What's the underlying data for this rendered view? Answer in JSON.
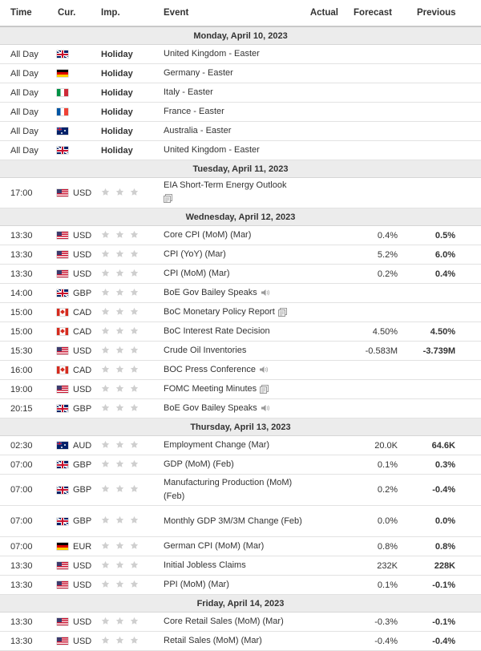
{
  "header": {
    "time": "Time",
    "currency": "Cur.",
    "importance": "Imp.",
    "event": "Event",
    "actual": "Actual",
    "forecast": "Forecast",
    "previous": "Previous"
  },
  "colors": {
    "day_bg": "#ececec",
    "star": "#cfcfcf",
    "text": "#333333"
  },
  "days": [
    {
      "label": "Monday, April 10, 2023",
      "events": [
        {
          "time": "All Day",
          "flag": "gb",
          "currency": "",
          "importance": "Holiday",
          "event": "United Kingdom - Easter",
          "icon": "",
          "actual": "",
          "forecast": "",
          "previous": ""
        },
        {
          "time": "All Day",
          "flag": "de",
          "currency": "",
          "importance": "Holiday",
          "event": "Germany - Easter",
          "icon": "",
          "actual": "",
          "forecast": "",
          "previous": ""
        },
        {
          "time": "All Day",
          "flag": "it",
          "currency": "",
          "importance": "Holiday",
          "event": "Italy - Easter",
          "icon": "",
          "actual": "",
          "forecast": "",
          "previous": ""
        },
        {
          "time": "All Day",
          "flag": "fr",
          "currency": "",
          "importance": "Holiday",
          "event": "France - Easter",
          "icon": "",
          "actual": "",
          "forecast": "",
          "previous": ""
        },
        {
          "time": "All Day",
          "flag": "au",
          "currency": "",
          "importance": "Holiday",
          "event": "Australia - Easter",
          "icon": "",
          "actual": "",
          "forecast": "",
          "previous": ""
        },
        {
          "time": "All Day",
          "flag": "gb",
          "currency": "",
          "importance": "Holiday",
          "event": "United Kingdom - Easter",
          "icon": "",
          "actual": "",
          "forecast": "",
          "previous": ""
        }
      ]
    },
    {
      "label": "Tuesday, April 11, 2023",
      "events": [
        {
          "time": "17:00",
          "flag": "us",
          "currency": "USD",
          "importance": "stars",
          "event": "EIA Short-Term Energy Outlook",
          "icon": "document-icon-block",
          "actual": "",
          "forecast": "",
          "previous": "",
          "rows": 2
        }
      ]
    },
    {
      "label": "Wednesday, April 12, 2023",
      "events": [
        {
          "time": "13:30",
          "flag": "us",
          "currency": "USD",
          "importance": "stars",
          "event": "Core CPI (MoM) (Mar)",
          "icon": "",
          "actual": "",
          "forecast": "0.4%",
          "previous": "0.5%"
        },
        {
          "time": "13:30",
          "flag": "us",
          "currency": "USD",
          "importance": "stars",
          "event": "CPI (YoY) (Mar)",
          "icon": "",
          "actual": "",
          "forecast": "5.2%",
          "previous": "6.0%"
        },
        {
          "time": "13:30",
          "flag": "us",
          "currency": "USD",
          "importance": "stars",
          "event": "CPI (MoM) (Mar)",
          "icon": "",
          "actual": "",
          "forecast": "0.2%",
          "previous": "0.4%"
        },
        {
          "time": "14:00",
          "flag": "gb",
          "currency": "GBP",
          "importance": "stars",
          "event": "BoE Gov Bailey Speaks",
          "icon": "speaker-icon",
          "actual": "",
          "forecast": "",
          "previous": ""
        },
        {
          "time": "15:00",
          "flag": "ca",
          "currency": "CAD",
          "importance": "stars",
          "event": "BoC Monetary Policy Report",
          "icon": "document-icon",
          "actual": "",
          "forecast": "",
          "previous": ""
        },
        {
          "time": "15:00",
          "flag": "ca",
          "currency": "CAD",
          "importance": "stars",
          "event": "BoC Interest Rate Decision",
          "icon": "",
          "actual": "",
          "forecast": "4.50%",
          "previous": "4.50%"
        },
        {
          "time": "15:30",
          "flag": "us",
          "currency": "USD",
          "importance": "stars",
          "event": "Crude Oil Inventories",
          "icon": "",
          "actual": "",
          "forecast": "-0.583M",
          "previous": "-3.739M"
        },
        {
          "time": "16:00",
          "flag": "ca",
          "currency": "CAD",
          "importance": "stars",
          "event": "BOC Press Conference",
          "icon": "speaker-icon",
          "actual": "",
          "forecast": "",
          "previous": ""
        },
        {
          "time": "19:00",
          "flag": "us",
          "currency": "USD",
          "importance": "stars",
          "event": "FOMC Meeting Minutes",
          "icon": "document-icon",
          "actual": "",
          "forecast": "",
          "previous": ""
        },
        {
          "time": "20:15",
          "flag": "gb",
          "currency": "GBP",
          "importance": "stars",
          "event": "BoE Gov Bailey Speaks",
          "icon": "speaker-icon",
          "actual": "",
          "forecast": "",
          "previous": ""
        }
      ]
    },
    {
      "label": "Thursday, April 13, 2023",
      "events": [
        {
          "time": "02:30",
          "flag": "au",
          "currency": "AUD",
          "importance": "stars",
          "event": "Employment Change (Mar)",
          "icon": "",
          "actual": "",
          "forecast": "20.0K",
          "previous": "64.6K"
        },
        {
          "time": "07:00",
          "flag": "gb",
          "currency": "GBP",
          "importance": "stars",
          "event": "GDP (MoM) (Feb)",
          "icon": "",
          "actual": "",
          "forecast": "0.1%",
          "previous": "0.3%"
        },
        {
          "time": "07:00",
          "flag": "gb",
          "currency": "GBP",
          "importance": "stars",
          "event": "Manufacturing Production (MoM) (Feb)",
          "icon": "",
          "actual": "",
          "forecast": "0.2%",
          "previous": "-0.4%",
          "rows": 3
        },
        {
          "time": "07:00",
          "flag": "gb",
          "currency": "GBP",
          "importance": "stars",
          "event": "Monthly GDP 3M/3M Change (Feb)",
          "icon": "",
          "actual": "",
          "forecast": "0.0%",
          "previous": "0.0%",
          "rows": 3
        },
        {
          "time": "07:00",
          "flag": "de",
          "currency": "EUR",
          "importance": "stars",
          "event": "German CPI (MoM) (Mar)",
          "icon": "",
          "actual": "",
          "forecast": "0.8%",
          "previous": "0.8%"
        },
        {
          "time": "13:30",
          "flag": "us",
          "currency": "USD",
          "importance": "stars",
          "event": "Initial Jobless Claims",
          "icon": "",
          "actual": "",
          "forecast": "232K",
          "previous": "228K"
        },
        {
          "time": "13:30",
          "flag": "us",
          "currency": "USD",
          "importance": "stars",
          "event": "PPI (MoM) (Mar)",
          "icon": "",
          "actual": "",
          "forecast": "0.1%",
          "previous": "-0.1%"
        }
      ]
    },
    {
      "label": "Friday, April 14, 2023",
      "events": [
        {
          "time": "13:30",
          "flag": "us",
          "currency": "USD",
          "importance": "stars",
          "event": "Core Retail Sales (MoM) (Mar)",
          "icon": "",
          "actual": "",
          "forecast": "-0.3%",
          "previous": "-0.1%"
        },
        {
          "time": "13:30",
          "flag": "us",
          "currency": "USD",
          "importance": "stars",
          "event": "Retail Sales (MoM) (Mar)",
          "icon": "",
          "actual": "",
          "forecast": "-0.4%",
          "previous": "-0.4%"
        }
      ]
    }
  ]
}
